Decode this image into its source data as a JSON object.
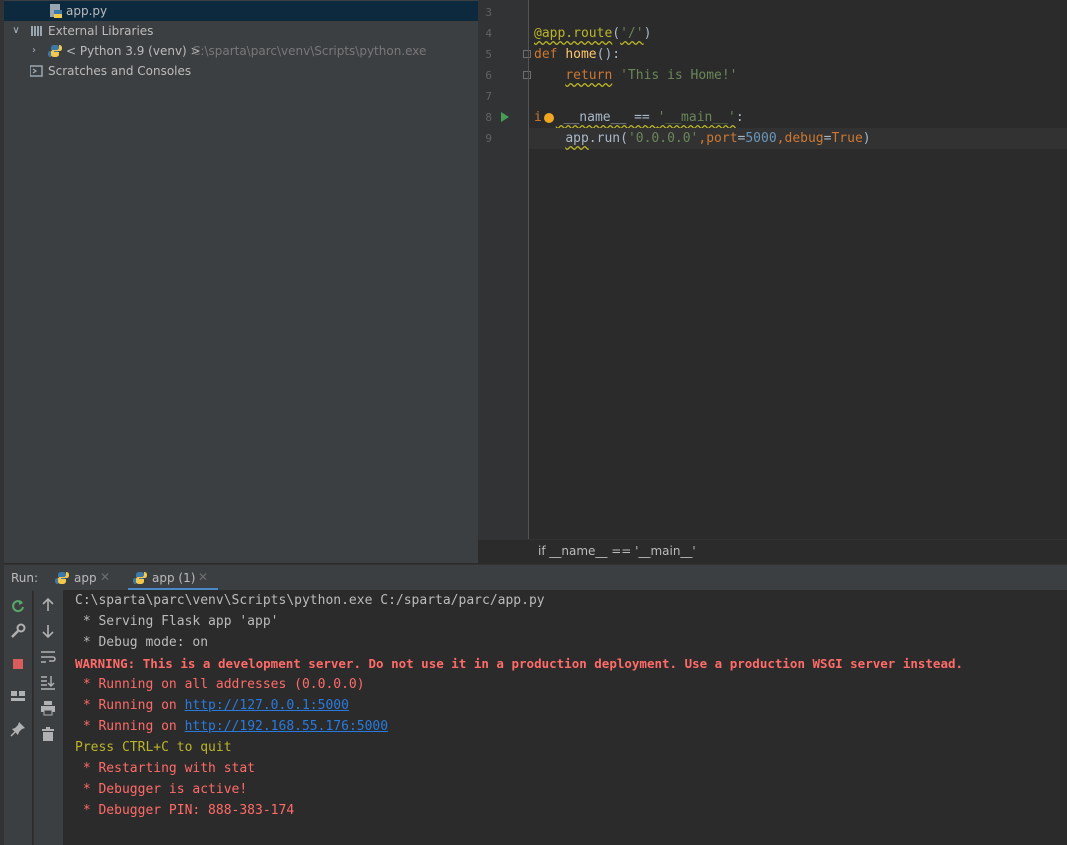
{
  "project_tree": {
    "items": [
      {
        "label": "app.py",
        "selected": true,
        "icon": "python-file-icon"
      },
      {
        "label": "External Libraries",
        "icon": "library-icon",
        "expanded": true
      },
      {
        "label": "< Python 3.9 (venv) >",
        "detail": "C:\\sparta\\parc\\venv\\Scripts\\python.exe",
        "icon": "python-icon",
        "expanded": false
      },
      {
        "label": "Scratches and Consoles",
        "icon": "scratches-icon"
      }
    ]
  },
  "editor": {
    "line_numbers": [
      "3",
      "4",
      "5",
      "6",
      "7",
      "8",
      "9"
    ],
    "current_line": "9",
    "breadcrumb": "if __name__ == '__main__'"
  },
  "run_panel": {
    "label": "Run:",
    "tabs": [
      {
        "label": "app",
        "active": false
      },
      {
        "label": "app (1)",
        "active": true
      }
    ],
    "console_lines": [
      {
        "text": "C:\\sparta\\parc\\venv\\Scripts\\python.exe C:/sparta/parc/app.py",
        "style": "normal"
      },
      {
        "text": " * Serving Flask app 'app'",
        "style": "normal"
      },
      {
        "text": " * Debug mode: on",
        "style": "normal"
      },
      {
        "text": "WARNING: This is a development server. Do not use it in a production deployment. Use a production WSGI server instead.",
        "style": "red-bold"
      },
      {
        "text": " * Running on all addresses (0.0.0.0)",
        "style": "red"
      },
      {
        "prefix": " * Running on ",
        "link": "http://127.0.0.1:5000",
        "style": "red"
      },
      {
        "prefix": " * Running on ",
        "link": "http://192.168.55.176:5000",
        "style": "red"
      },
      {
        "text": "Press CTRL+C to quit",
        "style": "yellow"
      },
      {
        "text": " * Restarting with stat",
        "style": "red"
      },
      {
        "text": " * Debugger is active!",
        "style": "red"
      },
      {
        "text": " * Debugger PIN: 888-383-174",
        "style": "red"
      }
    ]
  },
  "colors": {
    "background": "#2b2b2b",
    "panel": "#3c3f41",
    "selection": "#0d293e",
    "keyword": "#cc7832",
    "function": "#ffc66d",
    "string": "#6a8759",
    "number": "#6897bb",
    "decorator": "#bbb529",
    "console_error": "#ff6b68",
    "link": "#287bde"
  }
}
